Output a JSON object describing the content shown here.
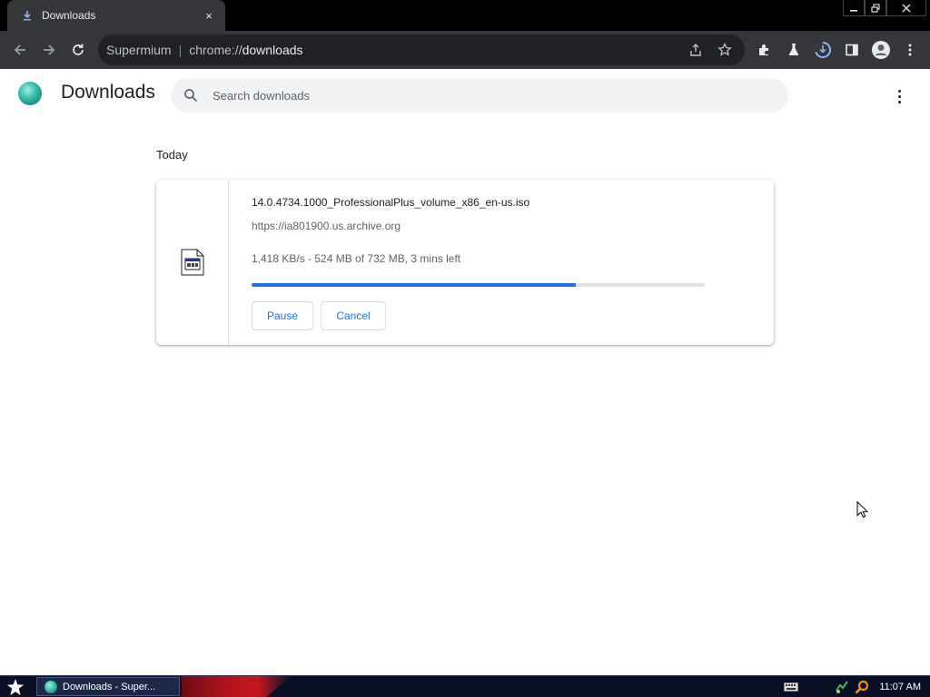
{
  "browser": {
    "tab": {
      "title": "Downloads",
      "close_label": "×"
    },
    "omnibox": {
      "site": "Supermium",
      "separator": "|",
      "scheme": "chrome://",
      "path": "downloads"
    }
  },
  "icons": {
    "back": "arrow-left-icon",
    "forward": "arrow-right-icon",
    "reload": "reload-icon",
    "share": "share-icon",
    "bookmark": "star-icon",
    "extensions": "puzzle-icon",
    "labs": "flask-icon",
    "downloads": "download-icon",
    "side_panel": "side-panel-icon",
    "profile": "account-icon",
    "menu": "kebab-menu-icon"
  },
  "page": {
    "title": "Downloads",
    "search": {
      "placeholder": "Search downloads"
    },
    "section_date": "Today",
    "downloads": [
      {
        "file_name": "14.0.4734.1000_ProfessionalPlus_volume_x86_en-us.iso",
        "url": "https://ia801900.us.archive.org",
        "status": "1,418 KB/s - 524 MB of 732 MB, 3 mins left",
        "progress_fraction": 0.716,
        "pause_label": "Pause",
        "cancel_label": "Cancel"
      }
    ]
  },
  "colors": {
    "accent": "#1a73e8",
    "toolbar": "#35363a",
    "omnibox": "#202124",
    "download_active": "#8ab4f8"
  },
  "taskbar": {
    "task_item_label": "Downloads - Super...",
    "clock": "11:07 AM"
  }
}
